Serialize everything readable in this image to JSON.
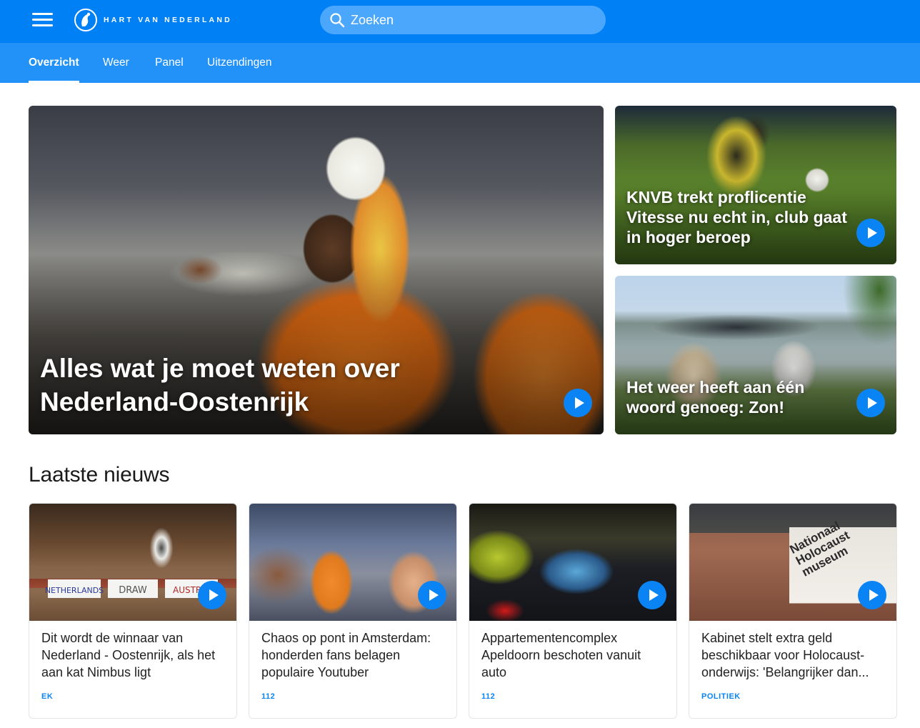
{
  "header": {
    "brand_name": "HART VAN NEDERLAND",
    "search_placeholder": "Zoeken",
    "colors": {
      "topbar": "#0080f5",
      "subnav": "#2291f8",
      "accent": "#0a84f5"
    },
    "icons": {
      "menu": "hamburger-menu-icon",
      "logo": "heart-logo-icon",
      "search": "search-icon"
    }
  },
  "subnav": {
    "tabs": [
      {
        "label": "Overzicht",
        "active": true
      },
      {
        "label": "Weer",
        "active": false
      },
      {
        "label": "Panel",
        "active": false
      },
      {
        "label": "Uitzendingen",
        "active": false
      }
    ]
  },
  "hero": {
    "main": {
      "title": "Alles wat je moet weten over Nederland-Oostenrijk",
      "has_video": true
    },
    "side": [
      {
        "title": "KNVB trekt proflicentie Vitesse nu echt in, club gaat in hoger beroep",
        "has_video": true
      },
      {
        "title": "Het weer heeft aan één woord genoeg: Zon!",
        "has_video": true
      }
    ]
  },
  "latest": {
    "title": "Laatste nieuws",
    "items": [
      {
        "headline": "Dit wordt de winnaar van Nederland - Oostenrijk, als het aan kat Nimbus ligt",
        "tag": "EK",
        "thumb_labels": [
          "NETHERLANDS",
          "DRAW",
          "AUSTRIA"
        ]
      },
      {
        "headline": "Chaos op pont in Amsterdam: honderden fans belagen populaire Youtuber",
        "tag": "112"
      },
      {
        "headline": "Appartementencomplex Apeldoorn beschoten vanuit auto",
        "tag": "112"
      },
      {
        "headline": "Kabinet stelt extra geld beschikbaar voor Holocaust-onderwijs: 'Belangrijker dan...",
        "tag": "POLITIEK",
        "thumb_sign": "Nationaal Holocaust museum"
      }
    ]
  }
}
